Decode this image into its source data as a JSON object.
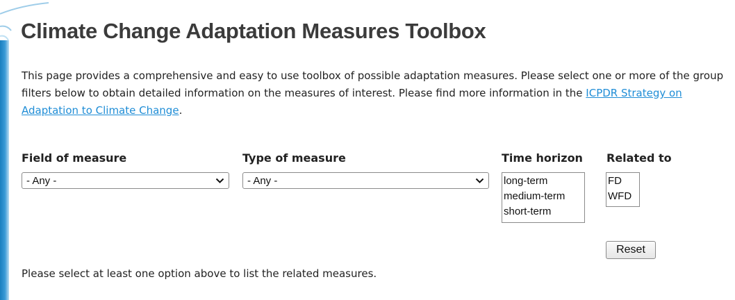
{
  "page": {
    "title": "Climate Change Adaptation Measures Toolbox",
    "intro_before_link": "This page provides a comprehensive and easy to use toolbox of possible adaptation measures. Please select one or more of the group filters below to obtain detailed information on the measures of interest. Please find more information in the ",
    "intro_link_text": "ICPDR Strategy on Adaptation to Climate Change",
    "intro_after_link": "."
  },
  "filters": {
    "field_of_measure": {
      "label": "Field of measure",
      "selected": "- Any -"
    },
    "type_of_measure": {
      "label": "Type of measure",
      "selected": "- Any -"
    },
    "time_horizon": {
      "label": "Time horizon",
      "options": [
        "long-term",
        "medium-term",
        "short-term"
      ]
    },
    "related_to": {
      "label": "Related to",
      "options": [
        "FD",
        "WFD"
      ]
    },
    "reset_label": "Reset"
  },
  "status": {
    "hint": "Please select at least one option above to list the related measures."
  },
  "colors": {
    "link": "#1f8dd6",
    "title": "#3b3b3b",
    "edge_accent": "#1a7fbf"
  },
  "icons": {
    "dropdown": "chevron-down-icon"
  }
}
